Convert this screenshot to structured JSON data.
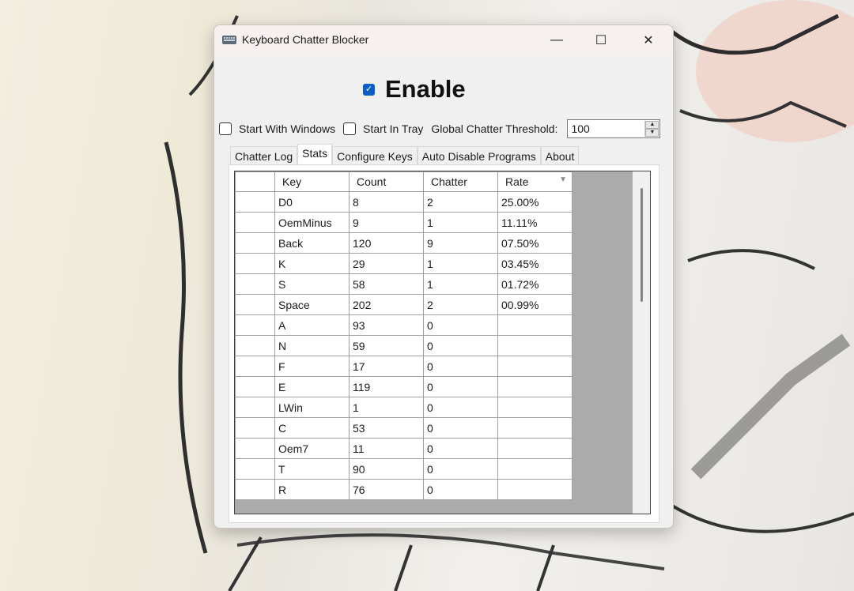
{
  "window": {
    "title": "Keyboard Chatter Blocker",
    "minimize_glyph": "—",
    "maximize_glyph": "☐",
    "close_glyph": "✕"
  },
  "enable": {
    "label": "Enable",
    "checked": true,
    "check_glyph": "✓"
  },
  "options": {
    "start_with_windows": {
      "label": "Start With Windows",
      "checked": false
    },
    "start_in_tray": {
      "label": "Start In Tray",
      "checked": false
    },
    "threshold_label": "Global Chatter Threshold:",
    "threshold_value": "100",
    "spin_up": "▲",
    "spin_down": "▼"
  },
  "tabs": [
    {
      "label": "Chatter Log",
      "active": false
    },
    {
      "label": "Stats",
      "active": true
    },
    {
      "label": "Configure Keys",
      "active": false
    },
    {
      "label": "Auto Disable Programs",
      "active": false
    },
    {
      "label": "About",
      "active": false
    }
  ],
  "grid": {
    "columns": [
      "Key",
      "Count",
      "Chatter",
      "Rate"
    ],
    "sort_glyph": "▼",
    "rows": [
      [
        "D0",
        "8",
        "2",
        "25.00%"
      ],
      [
        "OemMinus",
        "9",
        "1",
        "11.11%"
      ],
      [
        "Back",
        "120",
        "9",
        "07.50%"
      ],
      [
        "K",
        "29",
        "1",
        "03.45%"
      ],
      [
        "S",
        "58",
        "1",
        "01.72%"
      ],
      [
        "Space",
        "202",
        "2",
        "00.99%"
      ],
      [
        "A",
        "93",
        "0",
        ""
      ],
      [
        "N",
        "59",
        "0",
        ""
      ],
      [
        "F",
        "17",
        "0",
        ""
      ],
      [
        "E",
        "119",
        "0",
        ""
      ],
      [
        "LWin",
        "1",
        "0",
        ""
      ],
      [
        "C",
        "53",
        "0",
        ""
      ],
      [
        "Oem7",
        "11",
        "0",
        ""
      ],
      [
        "T",
        "90",
        "0",
        ""
      ],
      [
        "R",
        "76",
        "0",
        ""
      ]
    ]
  }
}
